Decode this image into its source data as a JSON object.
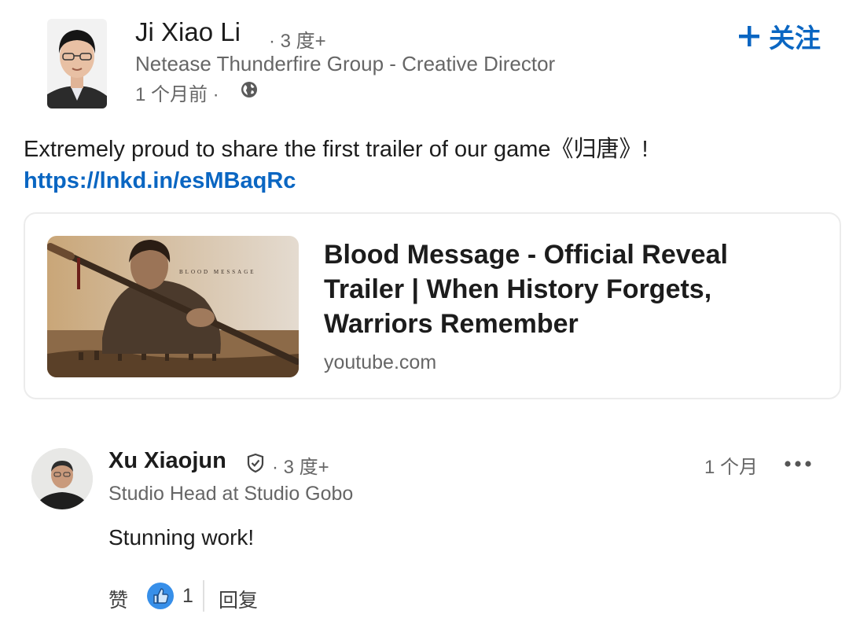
{
  "post": {
    "author": {
      "name": "Ji Xiao Li",
      "degree": "· 3 度+",
      "title": "Netease Thunderfire Group - Creative Director",
      "time": "1 个月前 ·"
    },
    "follow_label": "关注",
    "text": "Extremely proud to share the first trailer of our game《归唐》! ",
    "link": "https://lnkd.in/esMBaqRc"
  },
  "link_card": {
    "title": "Blood Message - Official Reveal Trailer | When History Forgets, Warriors Remember",
    "domain": "youtube.com",
    "thumbnail_text": "BLOOD MESSAGE"
  },
  "comment": {
    "author": "Xu Xiaojun",
    "degree": "· 3 度+",
    "title": "Studio Head at Studio Gobo",
    "time": "1 个月",
    "text": "Stunning work!",
    "like_label": "赞",
    "like_count": "1",
    "reply_label": "回复"
  },
  "colors": {
    "accent": "#0a66c2",
    "secondary_text": "#666666"
  },
  "icons": [
    "plus-icon",
    "globe-icon",
    "verified-icon",
    "more-icon",
    "like-reaction-icon"
  ]
}
